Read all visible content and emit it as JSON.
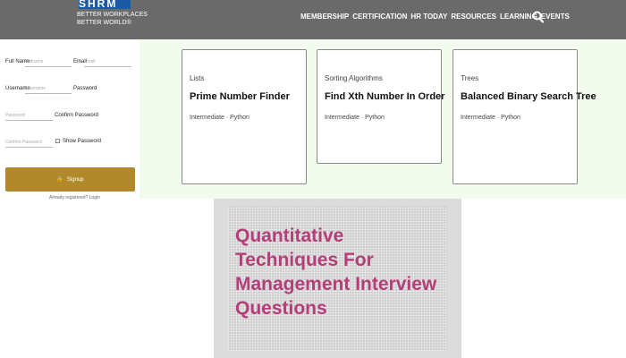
{
  "header": {
    "logo_text": "SHRM",
    "logo_tagline_1": "BETTER WORKPLACES",
    "logo_tagline_2": "BETTER WORLD®",
    "nav": [
      "MEMBERSHIP",
      "CERTIFICATION",
      "HR TODAY",
      "RESOURCES",
      "LEARNING",
      "EVENTS"
    ],
    "icons": {
      "search": "search-icon"
    }
  },
  "signup": {
    "full_name_label": "Full Name",
    "full_name_placeholder": "Fullname",
    "email_label": "Email",
    "email_placeholder": "Email",
    "username_label": "Username",
    "username_placeholder": "Username",
    "password_label": "Password",
    "password_placeholder": "Password",
    "confirm_label": "Confirm Password",
    "confirm_placeholder": "Confirm Password",
    "show_password_label": "Show Password",
    "button_label": "Signup",
    "below_text": "Already registered? Login"
  },
  "cards": [
    {
      "category": "Lists",
      "title": "Prime Number Finder",
      "meta": "Intermediate · Python"
    },
    {
      "category": "Sorting Algorithms",
      "title": "Find Xth Number In Order",
      "meta": "Intermediate · Python"
    },
    {
      "category": "Trees",
      "title": "Balanced Binary Search Tree",
      "meta": "Intermediate · Python"
    }
  ],
  "article": {
    "title": "Quantitative Techniques For Management Interview Questions"
  },
  "colors": {
    "header_bg": "#6a6a6a",
    "signup_button": "#b2892a",
    "article_title": "#b43e78",
    "strip_bg": "#f3faee"
  }
}
